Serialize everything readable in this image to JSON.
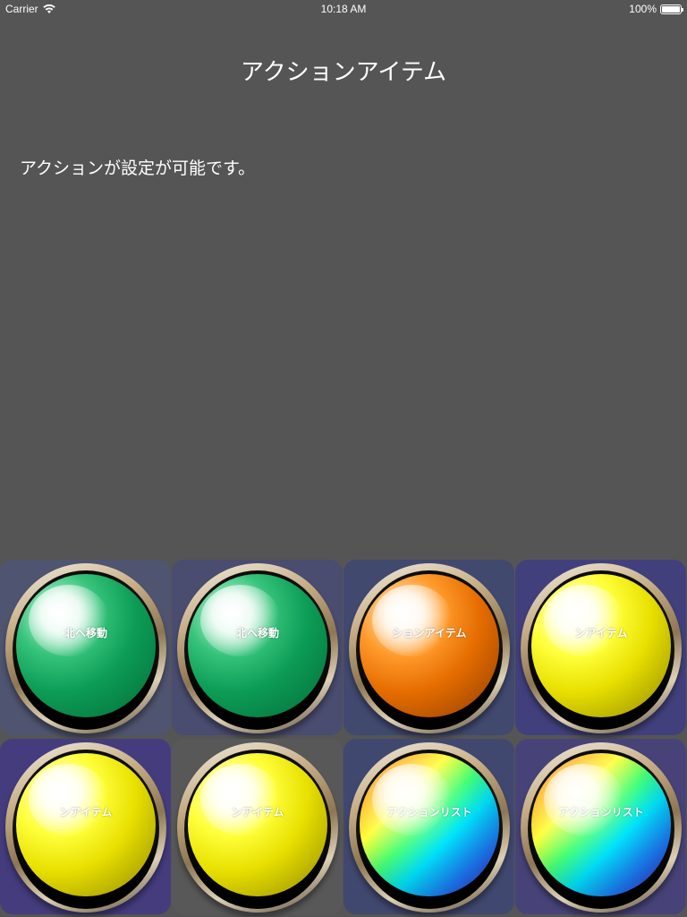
{
  "status_bar": {
    "carrier": "Carrier",
    "time": "10:18 AM",
    "battery_text": "100%",
    "battery_level": 1.0
  },
  "header": {
    "title": "アクションアイテム"
  },
  "content": {
    "description": "アクションが設定が可能です。"
  },
  "buttons": [
    {
      "label": "北へ移動",
      "face": "green",
      "tile_color": "#4f5470"
    },
    {
      "label": "北へ移動",
      "face": "green",
      "tile_color": "#4a4c70"
    },
    {
      "label": "ションアイテム",
      "face": "orange",
      "tile_color": "#41496f"
    },
    {
      "label": "ンアイテム",
      "face": "yellow",
      "tile_color": "#42407c"
    },
    {
      "label": "ンアイテム",
      "face": "yellow",
      "tile_color": "#443c7d"
    },
    {
      "label": "ンアイテム",
      "face": "yellow",
      "tile_color": "#585858"
    },
    {
      "label": "アクションリスト",
      "face": "rainbow",
      "tile_color": "#41486f"
    },
    {
      "label": "アクションリスト",
      "face": "rainbow",
      "tile_color": "#474378"
    }
  ],
  "icons": {
    "wifi": "wifi-icon",
    "battery": "battery-icon"
  }
}
